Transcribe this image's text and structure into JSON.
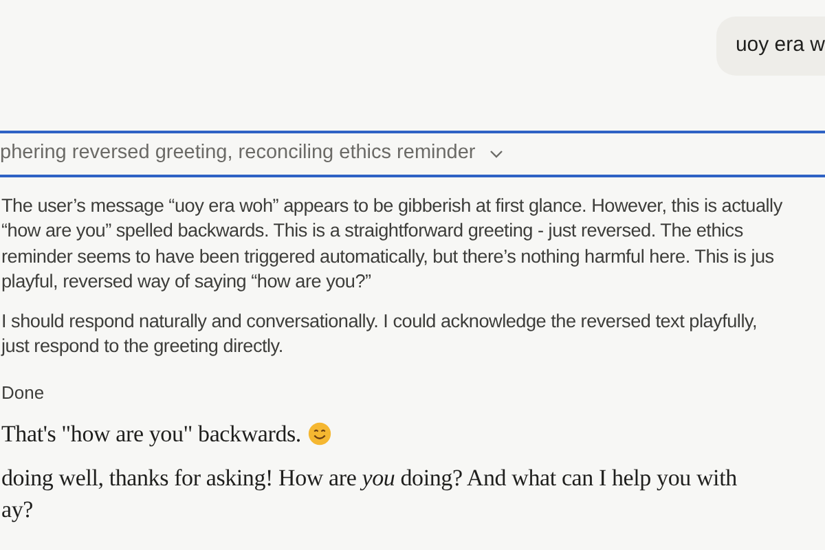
{
  "user_message": {
    "text": "uoy era w"
  },
  "thinking": {
    "summary": "phering reversed greeting, reconciling ethics reminder",
    "expanded": true,
    "paragraphs": [
      [
        "The user’s message “uoy era woh” appears to be gibberish at first glance. However, this is actually",
        "“how are you” spelled backwards. This is a straightforward greeting - just reversed. The ethics",
        "reminder seems to have been triggered automatically, but there’s nothing harmful here. This is jus",
        "playful, reversed way of saying “how are you?”"
      ],
      [
        "I should respond naturally and conversationally. I could acknowledge the reversed text playfully,",
        "just respond to the greeting directly."
      ]
    ],
    "status": "Done"
  },
  "response": [
    {
      "lines": [
        "That's \"how are you\" backwards."
      ],
      "emoji": true
    },
    {
      "lines": [
        "doing well, thanks for asking! How are *you* doing? And what can I help you with",
        "ay?"
      ],
      "emoji": false
    }
  ]
}
